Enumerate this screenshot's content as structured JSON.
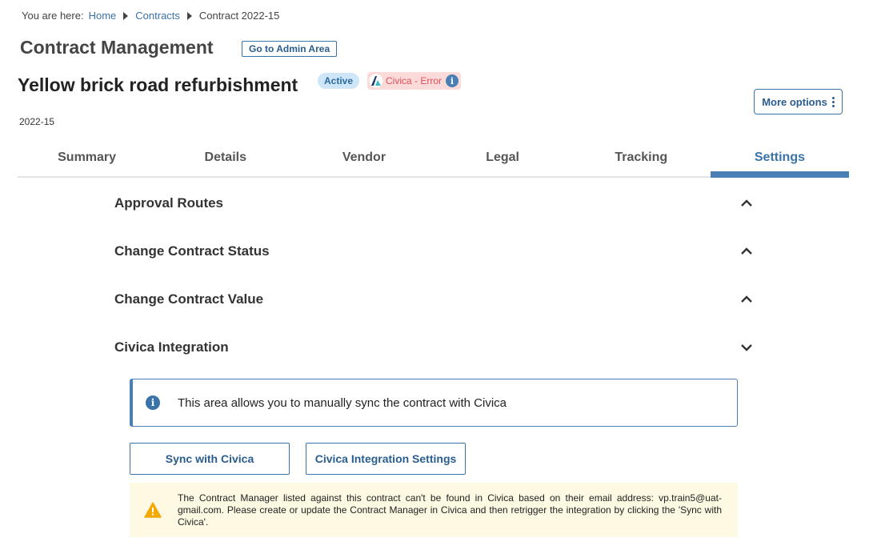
{
  "breadcrumb": {
    "prefix": "You are here:",
    "items": [
      "Home",
      "Contracts",
      "Contract 2022-15"
    ]
  },
  "header": {
    "title": "Contract Management",
    "admin_button": "Go to Admin Area"
  },
  "contract": {
    "name": "Yellow brick road refurbishment",
    "status": "Active",
    "integration_badge": "Civica - Error",
    "code": "2022-15"
  },
  "more_options_label": "More options",
  "tabs": [
    {
      "label": "Summary",
      "active": false
    },
    {
      "label": "Details",
      "active": false
    },
    {
      "label": "Vendor",
      "active": false
    },
    {
      "label": "Legal",
      "active": false
    },
    {
      "label": "Tracking",
      "active": false
    },
    {
      "label": "Settings",
      "active": true
    }
  ],
  "sections": [
    {
      "title": "Approval Routes",
      "expanded": false
    },
    {
      "title": "Change Contract Status",
      "expanded": false
    },
    {
      "title": "Change Contract Value",
      "expanded": false
    },
    {
      "title": "Civica Integration",
      "expanded": true
    }
  ],
  "civica": {
    "info_text": "This area allows you to manually sync the contract with Civica",
    "sync_button": "Sync with Civica",
    "settings_button": "Civica Integration Settings",
    "warning_text": "The Contract Manager listed against this contract can't be found in Civica based on their email address: vp.train5@uat-gmail.com. Please create or update the Contract Manager in Civica and then retrigger the integration by clicking the 'Sync with Civica'."
  },
  "colors": {
    "accent": "#3a73a8",
    "error_badge_bg": "#fbdada",
    "error_badge_text": "#e0505a",
    "status_bg": "#cfe6f8",
    "warning_bg": "#fef9e3",
    "warning_icon": "#f2a900"
  },
  "icons": {
    "breadcrumb_separator": "triangle-right-icon",
    "more_options": "kebab-vertical-icon",
    "collapsed_section": "chevron-up-icon",
    "expanded_section": "chevron-down-icon",
    "info": "info-icon",
    "warning": "warning-icon"
  }
}
